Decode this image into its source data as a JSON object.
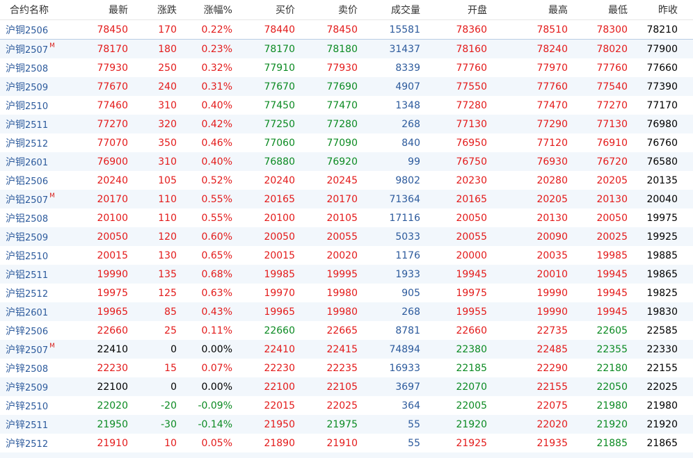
{
  "header": {
    "columns": [
      "合约名称",
      "最新",
      "涨跌",
      "涨幅%",
      "买价",
      "卖价",
      "成交量",
      "开盘",
      "最高",
      "最低",
      "昨收"
    ]
  },
  "main_mark": "M",
  "colors": {
    "up": "#e31a1a",
    "down": "#0b8a22",
    "flat": "#000000",
    "volume": "#2c5a9c",
    "name": "#2c5a9c",
    "alt_row_bg": "#f2f7fc"
  },
  "rows": [
    {
      "base": "沪铜",
      "code": "2506",
      "main": false,
      "last": "78450",
      "chg": "170",
      "pct": "0.22%",
      "bid": "78440",
      "ask": "78450",
      "vol": "15581",
      "open": "78360",
      "high": "78510",
      "low": "78300",
      "prev": "78210",
      "c": [
        "up",
        "up",
        "up",
        "up",
        "up",
        "up",
        "up",
        "up"
      ]
    },
    {
      "base": "沪铜",
      "code": "2507",
      "main": true,
      "last": "78170",
      "chg": "180",
      "pct": "0.23%",
      "bid": "78170",
      "ask": "78180",
      "vol": "31437",
      "open": "78160",
      "high": "78240",
      "low": "78020",
      "prev": "77900",
      "c": [
        "up",
        "up",
        "up",
        "down",
        "down",
        "up",
        "up",
        "up"
      ]
    },
    {
      "base": "沪铜",
      "code": "2508",
      "main": false,
      "last": "77930",
      "chg": "250",
      "pct": "0.32%",
      "bid": "77910",
      "ask": "77930",
      "vol": "8339",
      "open": "77760",
      "high": "77970",
      "low": "77760",
      "prev": "77660",
      "c": [
        "up",
        "up",
        "up",
        "down",
        "up",
        "up",
        "up",
        "up"
      ]
    },
    {
      "base": "沪铜",
      "code": "2509",
      "main": false,
      "last": "77670",
      "chg": "240",
      "pct": "0.31%",
      "bid": "77670",
      "ask": "77690",
      "vol": "4907",
      "open": "77550",
      "high": "77760",
      "low": "77540",
      "prev": "77390",
      "c": [
        "up",
        "up",
        "up",
        "down",
        "down",
        "up",
        "up",
        "up"
      ]
    },
    {
      "base": "沪铜",
      "code": "2510",
      "main": false,
      "last": "77460",
      "chg": "310",
      "pct": "0.40%",
      "bid": "77450",
      "ask": "77470",
      "vol": "1348",
      "open": "77280",
      "high": "77470",
      "low": "77270",
      "prev": "77170",
      "c": [
        "up",
        "up",
        "up",
        "down",
        "down",
        "up",
        "up",
        "up"
      ]
    },
    {
      "base": "沪铜",
      "code": "2511",
      "main": false,
      "last": "77270",
      "chg": "320",
      "pct": "0.42%",
      "bid": "77250",
      "ask": "77280",
      "vol": "268",
      "open": "77130",
      "high": "77290",
      "low": "77130",
      "prev": "76980",
      "c": [
        "up",
        "up",
        "up",
        "down",
        "down",
        "up",
        "up",
        "up"
      ]
    },
    {
      "base": "沪铜",
      "code": "2512",
      "main": false,
      "last": "77070",
      "chg": "350",
      "pct": "0.46%",
      "bid": "77060",
      "ask": "77090",
      "vol": "840",
      "open": "76950",
      "high": "77120",
      "low": "76910",
      "prev": "76760",
      "c": [
        "up",
        "up",
        "up",
        "down",
        "down",
        "up",
        "up",
        "up"
      ]
    },
    {
      "base": "沪铜",
      "code": "2601",
      "main": false,
      "last": "76900",
      "chg": "310",
      "pct": "0.40%",
      "bid": "76880",
      "ask": "76920",
      "vol": "99",
      "open": "76750",
      "high": "76930",
      "low": "76720",
      "prev": "76580",
      "c": [
        "up",
        "up",
        "up",
        "down",
        "down",
        "up",
        "up",
        "up"
      ]
    },
    {
      "base": "沪铝",
      "code": "2506",
      "main": false,
      "last": "20240",
      "chg": "105",
      "pct": "0.52%",
      "bid": "20240",
      "ask": "20245",
      "vol": "9802",
      "open": "20230",
      "high": "20280",
      "low": "20205",
      "prev": "20135",
      "c": [
        "up",
        "up",
        "up",
        "up",
        "up",
        "up",
        "up",
        "up"
      ]
    },
    {
      "base": "沪铝",
      "code": "2507",
      "main": true,
      "last": "20170",
      "chg": "110",
      "pct": "0.55%",
      "bid": "20165",
      "ask": "20170",
      "vol": "71364",
      "open": "20165",
      "high": "20205",
      "low": "20130",
      "prev": "20040",
      "c": [
        "up",
        "up",
        "up",
        "up",
        "up",
        "up",
        "up",
        "up"
      ]
    },
    {
      "base": "沪铝",
      "code": "2508",
      "main": false,
      "last": "20100",
      "chg": "110",
      "pct": "0.55%",
      "bid": "20100",
      "ask": "20105",
      "vol": "17116",
      "open": "20050",
      "high": "20130",
      "low": "20050",
      "prev": "19975",
      "c": [
        "up",
        "up",
        "up",
        "up",
        "up",
        "up",
        "up",
        "up"
      ]
    },
    {
      "base": "沪铝",
      "code": "2509",
      "main": false,
      "last": "20050",
      "chg": "120",
      "pct": "0.60%",
      "bid": "20050",
      "ask": "20055",
      "vol": "5033",
      "open": "20055",
      "high": "20090",
      "low": "20025",
      "prev": "19925",
      "c": [
        "up",
        "up",
        "up",
        "up",
        "up",
        "up",
        "up",
        "up"
      ]
    },
    {
      "base": "沪铝",
      "code": "2510",
      "main": false,
      "last": "20015",
      "chg": "130",
      "pct": "0.65%",
      "bid": "20015",
      "ask": "20020",
      "vol": "1176",
      "open": "20000",
      "high": "20035",
      "low": "19985",
      "prev": "19885",
      "c": [
        "up",
        "up",
        "up",
        "up",
        "up",
        "up",
        "up",
        "up"
      ]
    },
    {
      "base": "沪铝",
      "code": "2511",
      "main": false,
      "last": "19990",
      "chg": "135",
      "pct": "0.68%",
      "bid": "19985",
      "ask": "19995",
      "vol": "1933",
      "open": "19945",
      "high": "20010",
      "low": "19945",
      "prev": "19865",
      "c": [
        "up",
        "up",
        "up",
        "up",
        "up",
        "up",
        "up",
        "up"
      ]
    },
    {
      "base": "沪铝",
      "code": "2512",
      "main": false,
      "last": "19975",
      "chg": "125",
      "pct": "0.63%",
      "bid": "19970",
      "ask": "19980",
      "vol": "905",
      "open": "19975",
      "high": "19990",
      "low": "19945",
      "prev": "19825",
      "c": [
        "up",
        "up",
        "up",
        "up",
        "up",
        "up",
        "up",
        "up"
      ]
    },
    {
      "base": "沪铝",
      "code": "2601",
      "main": false,
      "last": "19965",
      "chg": "85",
      "pct": "0.43%",
      "bid": "19965",
      "ask": "19980",
      "vol": "268",
      "open": "19955",
      "high": "19990",
      "low": "19945",
      "prev": "19830",
      "c": [
        "up",
        "up",
        "up",
        "up",
        "up",
        "up",
        "up",
        "up"
      ]
    },
    {
      "base": "沪锌",
      "code": "2506",
      "main": false,
      "last": "22660",
      "chg": "25",
      "pct": "0.11%",
      "bid": "22660",
      "ask": "22665",
      "vol": "8781",
      "open": "22660",
      "high": "22735",
      "low": "22605",
      "prev": "22585",
      "c": [
        "up",
        "up",
        "up",
        "down",
        "up",
        "up",
        "up",
        "down"
      ]
    },
    {
      "base": "沪锌",
      "code": "2507",
      "main": true,
      "last": "22410",
      "chg": "0",
      "pct": "0.00%",
      "bid": "22410",
      "ask": "22415",
      "vol": "74894",
      "open": "22380",
      "high": "22485",
      "low": "22355",
      "prev": "22330",
      "c": [
        "flat",
        "flat",
        "flat",
        "up",
        "up",
        "down",
        "up",
        "down"
      ]
    },
    {
      "base": "沪锌",
      "code": "2508",
      "main": false,
      "last": "22230",
      "chg": "15",
      "pct": "0.07%",
      "bid": "22230",
      "ask": "22235",
      "vol": "16933",
      "open": "22185",
      "high": "22290",
      "low": "22180",
      "prev": "22155",
      "c": [
        "up",
        "up",
        "up",
        "up",
        "up",
        "down",
        "up",
        "down"
      ]
    },
    {
      "base": "沪锌",
      "code": "2509",
      "main": false,
      "last": "22100",
      "chg": "0",
      "pct": "0.00%",
      "bid": "22100",
      "ask": "22105",
      "vol": "3697",
      "open": "22070",
      "high": "22155",
      "low": "22050",
      "prev": "22025",
      "c": [
        "flat",
        "flat",
        "flat",
        "up",
        "up",
        "down",
        "up",
        "down"
      ]
    },
    {
      "base": "沪锌",
      "code": "2510",
      "main": false,
      "last": "22020",
      "chg": "-20",
      "pct": "-0.09%",
      "bid": "22015",
      "ask": "22025",
      "vol": "364",
      "open": "22005",
      "high": "22075",
      "low": "21980",
      "prev": "21980",
      "c": [
        "down",
        "down",
        "down",
        "up",
        "up",
        "down",
        "up",
        "down"
      ]
    },
    {
      "base": "沪锌",
      "code": "2511",
      "main": false,
      "last": "21950",
      "chg": "-30",
      "pct": "-0.14%",
      "bid": "21950",
      "ask": "21975",
      "vol": "55",
      "open": "21920",
      "high": "22020",
      "low": "21920",
      "prev": "21920",
      "c": [
        "down",
        "down",
        "down",
        "up",
        "down",
        "down",
        "up",
        "down"
      ]
    },
    {
      "base": "沪锌",
      "code": "2512",
      "main": false,
      "last": "21910",
      "chg": "10",
      "pct": "0.05%",
      "bid": "21890",
      "ask": "21910",
      "vol": "55",
      "open": "21925",
      "high": "21935",
      "low": "21885",
      "prev": "21865",
      "c": [
        "up",
        "up",
        "up",
        "up",
        "up",
        "up",
        "up",
        "down"
      ]
    }
  ]
}
